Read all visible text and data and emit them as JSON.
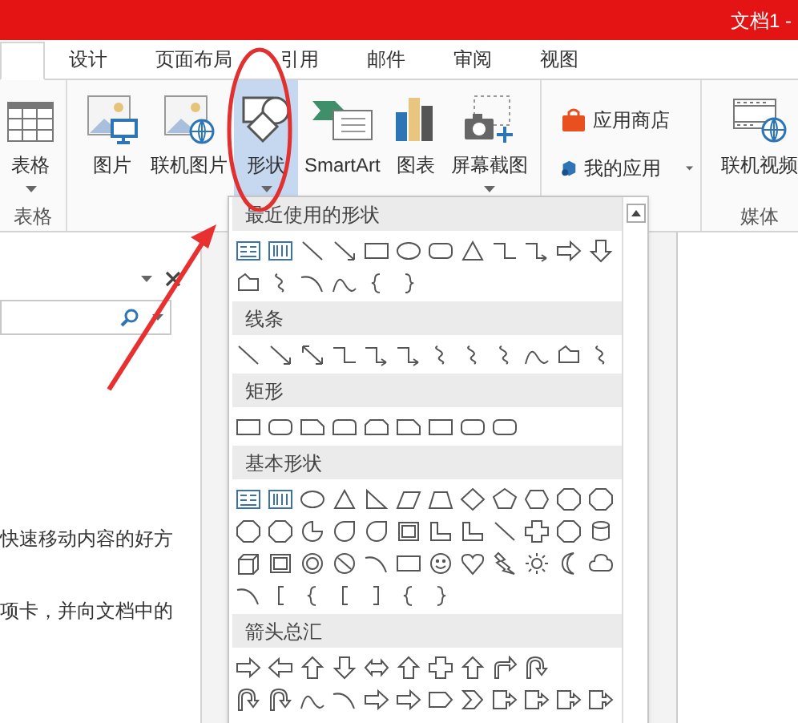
{
  "window": {
    "title": "文档1 -"
  },
  "tabs": [
    {
      "selected": true
    },
    {
      "label": "设计",
      "selected": false
    },
    {
      "label": "页面布局",
      "selected": false
    },
    {
      "label": "引用",
      "selected": false
    },
    {
      "label": "邮件",
      "selected": false
    },
    {
      "label": "审阅",
      "selected": false
    },
    {
      "label": "视图",
      "selected": false
    }
  ],
  "ribbon": {
    "groups": [
      {
        "label": "表格",
        "buttons": [
          {
            "kind": "large",
            "label": "表格",
            "dropdown": true,
            "pressed": false
          }
        ]
      },
      {
        "buttons": [
          {
            "kind": "large",
            "label": "图片",
            "dropdown": false,
            "pressed": false
          },
          {
            "kind": "large",
            "label": "联机图片",
            "dropdown": false,
            "pressed": false
          },
          {
            "kind": "large",
            "label": "形状",
            "dropdown": true,
            "pressed": true
          },
          {
            "kind": "large",
            "label": "SmartArt",
            "dropdown": false,
            "pressed": false
          },
          {
            "kind": "large",
            "label": "图表",
            "dropdown": false,
            "pressed": false
          },
          {
            "kind": "large",
            "label": "屏幕截图",
            "dropdown": true,
            "pressed": false
          }
        ]
      },
      {
        "buttons": [
          {
            "kind": "small",
            "label": "应用商店",
            "dropdown": false,
            "pressed": false
          },
          {
            "kind": "small",
            "label": "我的应用",
            "dropdown": true,
            "pressed": false
          }
        ]
      },
      {
        "label": "媒体",
        "buttons": [
          {
            "kind": "large",
            "label": "联机视频",
            "dropdown": false,
            "pressed": false
          }
        ]
      }
    ]
  },
  "navigation_pane": {
    "paragraphs": [
      "快速移动内容的好方",
      "项卡，并向文档中的"
    ]
  },
  "shapes_gallery": {
    "sections": [
      {
        "title": "最近使用的形状"
      },
      {
        "title": "线条"
      },
      {
        "title": "矩形"
      },
      {
        "title": "基本形状"
      },
      {
        "title": "箭头总汇"
      }
    ]
  }
}
